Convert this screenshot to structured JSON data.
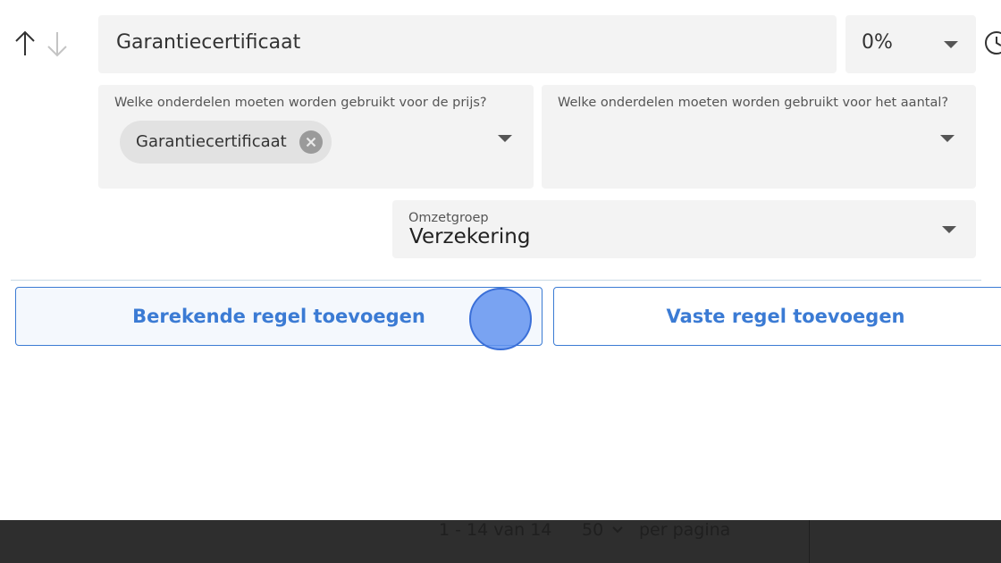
{
  "rule": {
    "name_value": "Garantiecertificaat",
    "percentage_value": "0%"
  },
  "parts_price": {
    "label": "Welke onderdelen moeten worden gebruikt voor de prijs?",
    "chips": [
      "Garantiecertificaat"
    ]
  },
  "parts_amount": {
    "label": "Welke onderdelen moeten worden gebruikt voor het aantal?"
  },
  "revenue_group": {
    "label": "Omzetgroep",
    "value": "Verzekering"
  },
  "actions": {
    "add_calculated_rule": "Berekende regel toevoegen",
    "add_fixed_rule": "Vaste regel toevoegen"
  },
  "pagination": {
    "range": "1 - 14 van 14",
    "page_size": "50",
    "per_page_label": "per pagina"
  },
  "colors": {
    "accent": "#3b7bd4",
    "field_bg": "#f3f3f3",
    "chip_bg": "#e2e2e2",
    "footer_bg": "#2e2e2e"
  },
  "icons": {
    "move_up": "arrow-up-icon",
    "move_down": "arrow-down-icon",
    "history": "clock-icon",
    "remove_chip": "close-circle-icon",
    "dropdown": "caret-down-icon"
  }
}
